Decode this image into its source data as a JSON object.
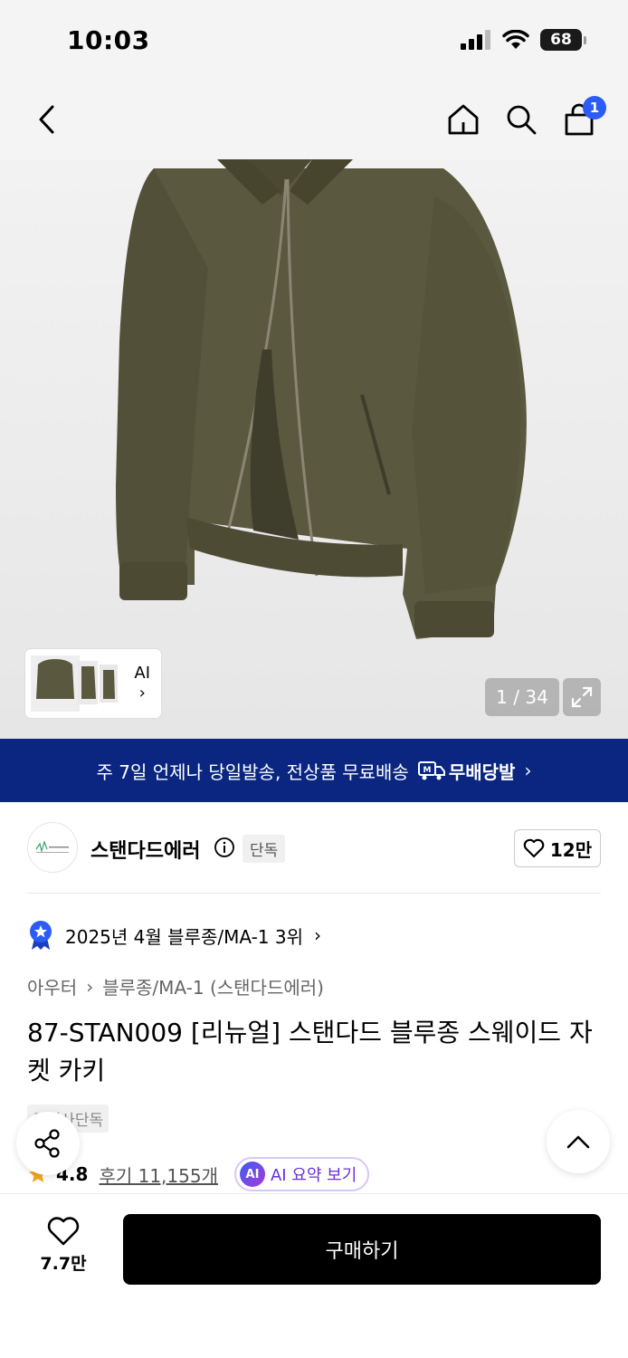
{
  "status_bar": {
    "time": "10:03",
    "battery": "68"
  },
  "nav": {
    "cart_count": "1"
  },
  "gallery": {
    "thumb_label": "AI",
    "counter": "1 / 34"
  },
  "shipping_banner": {
    "text": "주 7일 언제나 당일발송, 전상품 무료배송",
    "logo_text": "무배당발"
  },
  "brand": {
    "name": "스탠다드에러",
    "tag": "단독",
    "likes": "12만"
  },
  "ranking": {
    "text": "2025년 4월 블루종/MA-1 3위"
  },
  "breadcrumb": {
    "level1": "아우터",
    "level2": "블루종/MA-1 (스탠다드에러)"
  },
  "product": {
    "title": "87-STAN009 [리뉴얼] 스탠다드 블루종 스웨이드 자켓 카키",
    "exclusive_tag": "무신사단독",
    "rating": "4.8",
    "reviews": "후기 11,155개",
    "ai_summary_label": "AI 요약 보기",
    "ai_badge": "AI"
  },
  "bottom_bar": {
    "wish_count": "7.7만",
    "buy_label": "구매하기"
  },
  "colors": {
    "banner": "#0a2680",
    "badge": "#2b5cf5",
    "ai_purple": "#6a32d8",
    "jacket": "#5b5840"
  }
}
